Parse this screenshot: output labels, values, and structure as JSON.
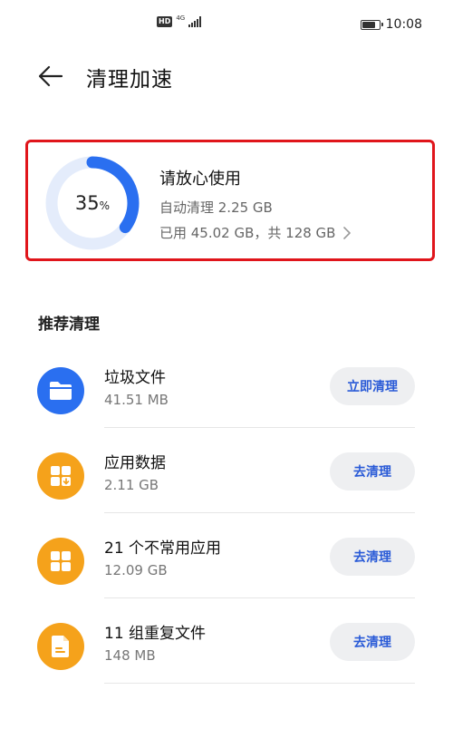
{
  "status_bar": {
    "hd": "HD",
    "network": "4G",
    "time": "10:08",
    "battery_level": 0.85
  },
  "header": {
    "back_icon": "arrow-left-icon",
    "title": "清理加速"
  },
  "storage": {
    "percent": 35,
    "percent_unit": "%",
    "status": "请放心使用",
    "auto_clean": "自动清理 2.25 GB",
    "usage": "已用 45.02 GB，共 128 GB",
    "chevron_icon": "chevron-right-icon",
    "colors": {
      "ring_fill": "#2a6ff0",
      "ring_track": "#e4ecfb",
      "highlight_border": "#e0151b"
    }
  },
  "section": {
    "title": "推荐清理"
  },
  "items": [
    {
      "title": "垃圾文件",
      "subtitle": "41.51 MB",
      "button": "立即清理",
      "icon": "folder-icon",
      "icon_color": "#2a6ff0"
    },
    {
      "title": "应用数据",
      "subtitle": "2.11 GB",
      "button": "去清理",
      "icon": "app-data-icon",
      "icon_color": "#f5a21b"
    },
    {
      "title": "21 个不常用应用",
      "subtitle": "12.09 GB",
      "button": "去清理",
      "icon": "apps-grid-icon",
      "icon_color": "#f5a21b"
    },
    {
      "title": "11 组重复文件",
      "subtitle": "148 MB",
      "button": "去清理",
      "icon": "duplicate-file-icon",
      "icon_color": "#f5a21b"
    }
  ]
}
